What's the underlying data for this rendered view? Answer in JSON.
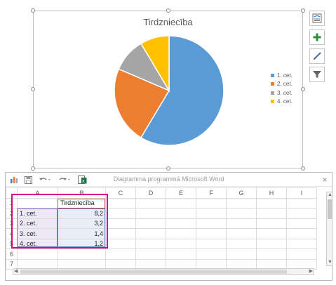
{
  "chart_data": {
    "type": "pie",
    "title": "Tirdzniecība",
    "categories": [
      "1. cet.",
      "2. cet.",
      "3. cet.",
      "4. cet."
    ],
    "values": [
      8.2,
      3.2,
      1.4,
      1.2
    ],
    "colors": [
      "#5b9bd5",
      "#ed7d31",
      "#a5a5a5",
      "#ffc000"
    ],
    "legend_position": "right"
  },
  "chart_tools": [
    {
      "icon": "layout-options-icon"
    },
    {
      "icon": "chart-elements-plus-icon"
    },
    {
      "icon": "chart-styles-brush-icon"
    },
    {
      "icon": "chart-filters-icon"
    }
  ],
  "spreadsheet": {
    "title": "Diagramma programmā Microsoft Word",
    "close": "×",
    "toolbar_icons": [
      "edit-data-icon",
      "save-icon",
      "undo-icon",
      "redo-icon",
      "excel-icon"
    ],
    "columns": [
      "A",
      "B",
      "C",
      "D",
      "E",
      "F",
      "G",
      "H",
      "I"
    ],
    "row_numbers": [
      "1",
      "2",
      "3",
      "4",
      "5",
      "6",
      "7"
    ],
    "header_cell": "Tirdzniecība",
    "rows": [
      {
        "label": "1. cet.",
        "value": "8,2"
      },
      {
        "label": "2. cet.",
        "value": "3,2"
      },
      {
        "label": "3. cet.",
        "value": "1,4"
      },
      {
        "label": "4. cet.",
        "value": "1,2"
      }
    ]
  }
}
